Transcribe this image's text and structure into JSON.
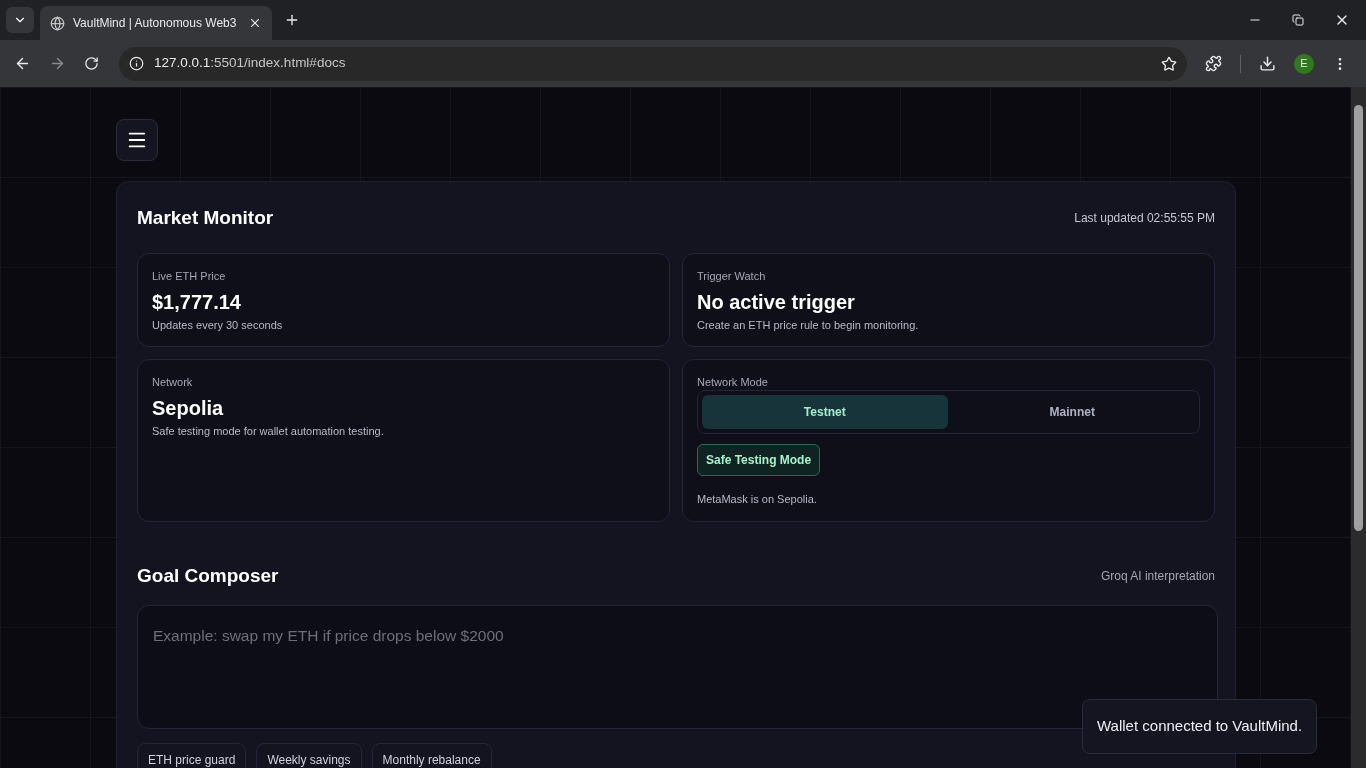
{
  "browser": {
    "tab_title": "VaultMind | Autonomous Web3",
    "url_host": "127.0.0.1",
    "url_rest": ":5501/index.html#docs",
    "profile_initial": "E"
  },
  "market_monitor": {
    "title": "Market Monitor",
    "last_updated": "Last updated 02:55:55 PM",
    "cards": [
      {
        "kind": "stat",
        "label": "Live ETH Price",
        "value": "$1,777.14",
        "note": "Updates every 30 seconds"
      },
      {
        "kind": "stat",
        "label": "Trigger Watch",
        "value": "No active trigger",
        "note": "Create an ETH price rule to begin monitoring."
      },
      {
        "kind": "stat",
        "label": "Network",
        "value": "Sepolia",
        "note": "Safe testing mode for wallet automation testing."
      },
      {
        "kind": "mode",
        "label": "Network Mode",
        "options": [
          {
            "label": "Testnet",
            "selected": true
          },
          {
            "label": "Mainnet",
            "selected": false
          }
        ],
        "badge": "Safe Testing Mode",
        "note": "MetaMask is on Sepolia."
      }
    ]
  },
  "goal_composer": {
    "title": "Goal Composer",
    "caption": "Groq AI interpretation",
    "placeholder": "Example: swap my ETH if price drops below $2000",
    "presets": [
      "ETH price guard",
      "Weekly savings",
      "Monthly rebalance"
    ]
  },
  "toast": "Wallet connected to VaultMind."
}
